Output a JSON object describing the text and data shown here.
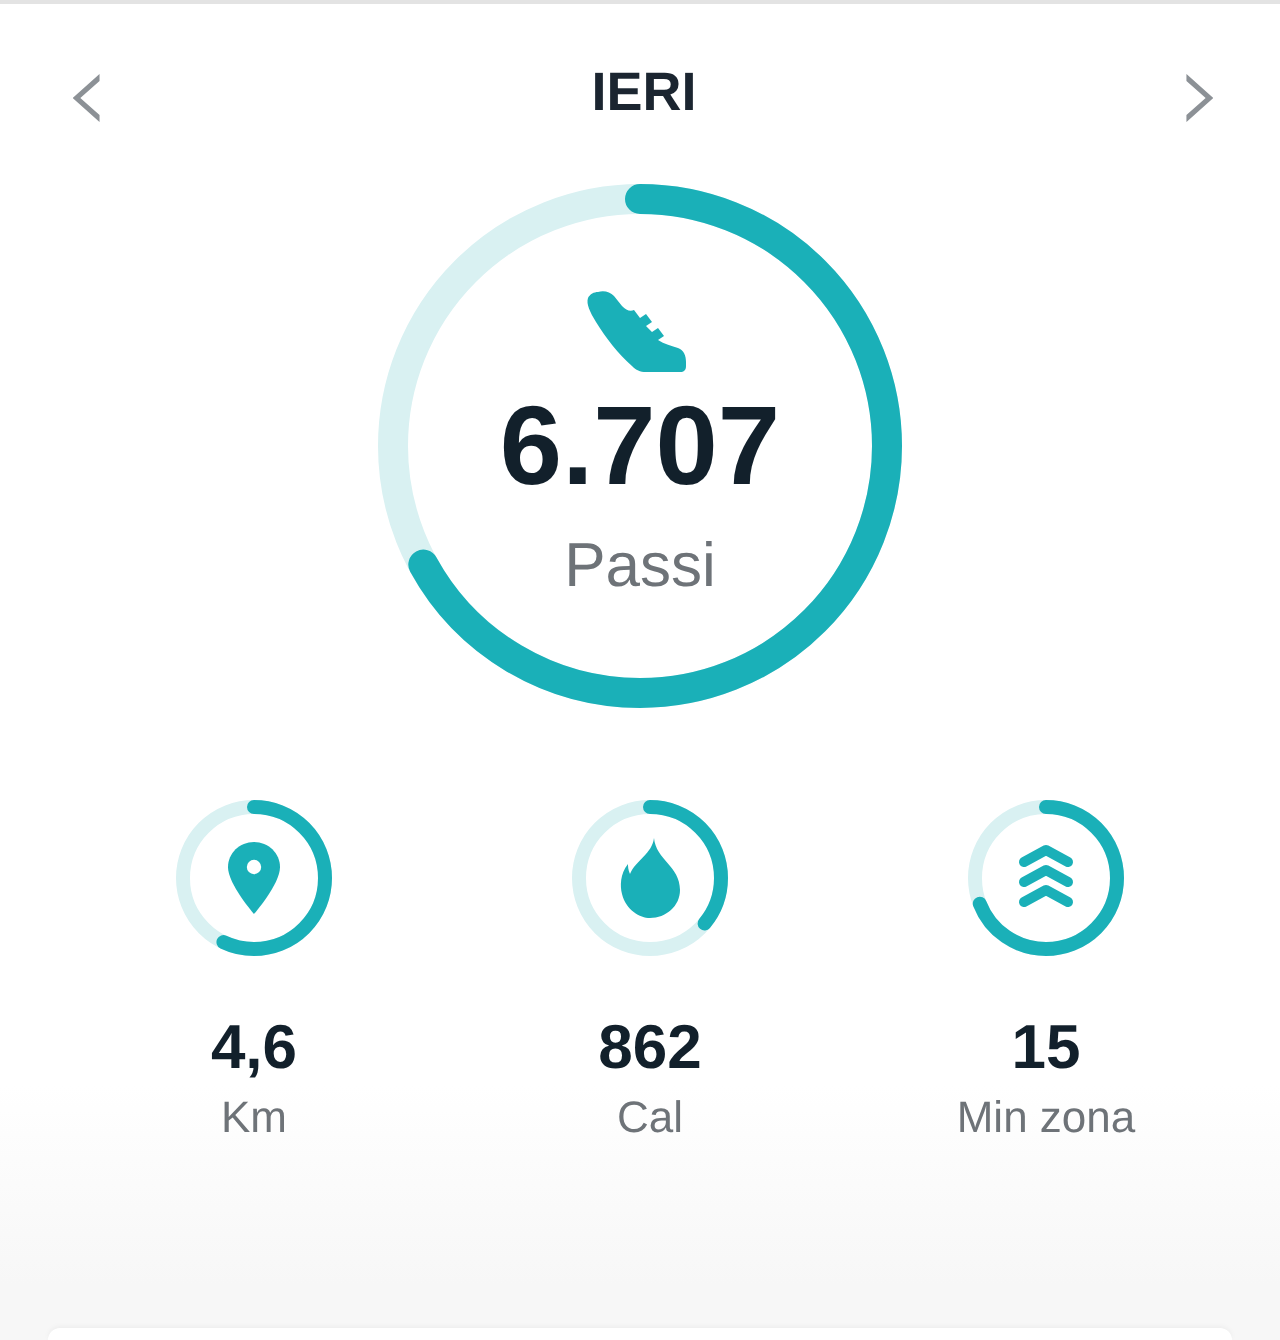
{
  "header": {
    "title": "IERI",
    "prev": "‹",
    "next": "›"
  },
  "main": {
    "value": "6.707",
    "label": "Passi",
    "level": 0.67
  },
  "stats": [
    {
      "kind": "distance",
      "value": "4,6",
      "label": "Km",
      "level": 0.57
    },
    {
      "kind": "calories",
      "value": "862",
      "label": "Cal",
      "level": 0.36
    },
    {
      "kind": "zone",
      "value": "15",
      "label": "Min zona",
      "level": 0.69
    }
  ]
}
